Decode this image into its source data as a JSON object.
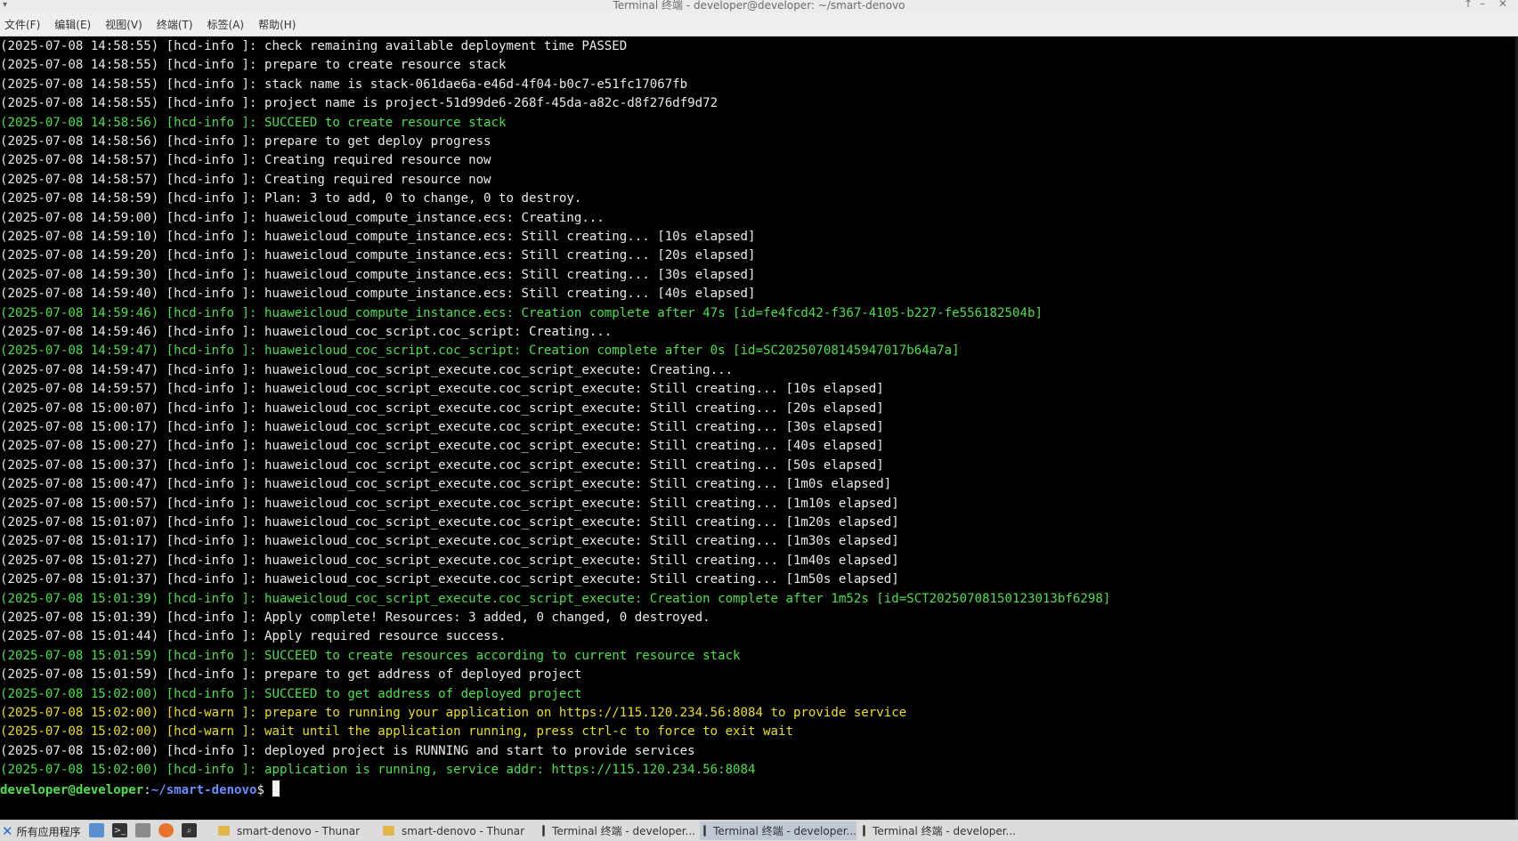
{
  "window": {
    "title": "Terminal 终端 - developer@developer: ~/smart-denovo",
    "menu_glyph": "▾",
    "controls": [
      "↑",
      "–",
      "✕"
    ]
  },
  "menu": [
    "文件(F)",
    "编辑(E)",
    "视图(V)",
    "终端(T)",
    "标签(A)",
    "帮助(H)"
  ],
  "terminal": {
    "lines": [
      {
        "text": "(2025-07-08 14:58:55) [hcd-info ]: check remaining available deployment time PASSED",
        "kind": "info"
      },
      {
        "text": "(2025-07-08 14:58:55) [hcd-info ]: prepare to create resource stack",
        "kind": "info"
      },
      {
        "text": "(2025-07-08 14:58:55) [hcd-info ]: stack name is stack-061dae6a-e46d-4f04-b0c7-e51fc17067fb",
        "kind": "info"
      },
      {
        "text": "(2025-07-08 14:58:55) [hcd-info ]: project name is project-51d99de6-268f-45da-a82c-d8f276df9d72",
        "kind": "info"
      },
      {
        "text": "(2025-07-08 14:58:56) [hcd-info ]: SUCCEED to create resource stack",
        "kind": "success"
      },
      {
        "text": "(2025-07-08 14:58:56) [hcd-info ]: prepare to get deploy progress",
        "kind": "info"
      },
      {
        "text": "(2025-07-08 14:58:57) [hcd-info ]: Creating required resource now",
        "kind": "info"
      },
      {
        "text": "(2025-07-08 14:58:57) [hcd-info ]: Creating required resource now",
        "kind": "info"
      },
      {
        "text": "(2025-07-08 14:58:59) [hcd-info ]: Plan: 3 to add, 0 to change, 0 to destroy.",
        "kind": "info"
      },
      {
        "text": "(2025-07-08 14:59:00) [hcd-info ]: huaweicloud_compute_instance.ecs: Creating...",
        "kind": "info"
      },
      {
        "text": "(2025-07-08 14:59:10) [hcd-info ]: huaweicloud_compute_instance.ecs: Still creating... [10s elapsed]",
        "kind": "info"
      },
      {
        "text": "(2025-07-08 14:59:20) [hcd-info ]: huaweicloud_compute_instance.ecs: Still creating... [20s elapsed]",
        "kind": "info"
      },
      {
        "text": "(2025-07-08 14:59:30) [hcd-info ]: huaweicloud_compute_instance.ecs: Still creating... [30s elapsed]",
        "kind": "info"
      },
      {
        "text": "(2025-07-08 14:59:40) [hcd-info ]: huaweicloud_compute_instance.ecs: Still creating... [40s elapsed]",
        "kind": "info"
      },
      {
        "text": "(2025-07-08 14:59:46) [hcd-info ]: huaweicloud_compute_instance.ecs: Creation complete after 47s [id=fe4fcd42-f367-4105-b227-fe556182504b]",
        "kind": "success"
      },
      {
        "text": "(2025-07-08 14:59:46) [hcd-info ]: huaweicloud_coc_script.coc_script: Creating...",
        "kind": "info"
      },
      {
        "text": "(2025-07-08 14:59:47) [hcd-info ]: huaweicloud_coc_script.coc_script: Creation complete after 0s [id=SC20250708145947017b64a7a]",
        "kind": "success"
      },
      {
        "text": "(2025-07-08 14:59:47) [hcd-info ]: huaweicloud_coc_script_execute.coc_script_execute: Creating...",
        "kind": "info"
      },
      {
        "text": "(2025-07-08 14:59:57) [hcd-info ]: huaweicloud_coc_script_execute.coc_script_execute: Still creating... [10s elapsed]",
        "kind": "info"
      },
      {
        "text": "(2025-07-08 15:00:07) [hcd-info ]: huaweicloud_coc_script_execute.coc_script_execute: Still creating... [20s elapsed]",
        "kind": "info"
      },
      {
        "text": "(2025-07-08 15:00:17) [hcd-info ]: huaweicloud_coc_script_execute.coc_script_execute: Still creating... [30s elapsed]",
        "kind": "info"
      },
      {
        "text": "(2025-07-08 15:00:27) [hcd-info ]: huaweicloud_coc_script_execute.coc_script_execute: Still creating... [40s elapsed]",
        "kind": "info"
      },
      {
        "text": "(2025-07-08 15:00:37) [hcd-info ]: huaweicloud_coc_script_execute.coc_script_execute: Still creating... [50s elapsed]",
        "kind": "info"
      },
      {
        "text": "(2025-07-08 15:00:47) [hcd-info ]: huaweicloud_coc_script_execute.coc_script_execute: Still creating... [1m0s elapsed]",
        "kind": "info"
      },
      {
        "text": "(2025-07-08 15:00:57) [hcd-info ]: huaweicloud_coc_script_execute.coc_script_execute: Still creating... [1m10s elapsed]",
        "kind": "info"
      },
      {
        "text": "(2025-07-08 15:01:07) [hcd-info ]: huaweicloud_coc_script_execute.coc_script_execute: Still creating... [1m20s elapsed]",
        "kind": "info"
      },
      {
        "text": "(2025-07-08 15:01:17) [hcd-info ]: huaweicloud_coc_script_execute.coc_script_execute: Still creating... [1m30s elapsed]",
        "kind": "info"
      },
      {
        "text": "(2025-07-08 15:01:27) [hcd-info ]: huaweicloud_coc_script_execute.coc_script_execute: Still creating... [1m40s elapsed]",
        "kind": "info"
      },
      {
        "text": "(2025-07-08 15:01:37) [hcd-info ]: huaweicloud_coc_script_execute.coc_script_execute: Still creating... [1m50s elapsed]",
        "kind": "info"
      },
      {
        "text": "(2025-07-08 15:01:39) [hcd-info ]: huaweicloud_coc_script_execute.coc_script_execute: Creation complete after 1m52s [id=SCT20250708150123013bf6298]",
        "kind": "success"
      },
      {
        "text": "(2025-07-08 15:01:39) [hcd-info ]: Apply complete! Resources: 3 added, 0 changed, 0 destroyed.",
        "kind": "info"
      },
      {
        "text": "(2025-07-08 15:01:44) [hcd-info ]: Apply required resource success.",
        "kind": "info"
      },
      {
        "text": "(2025-07-08 15:01:59) [hcd-info ]: SUCCEED to create resources according to current resource stack",
        "kind": "success"
      },
      {
        "text": "(2025-07-08 15:01:59) [hcd-info ]: prepare to get address of deployed project",
        "kind": "info"
      },
      {
        "text": "(2025-07-08 15:02:00) [hcd-info ]: SUCCEED to get address of deployed project",
        "kind": "success"
      },
      {
        "text": "(2025-07-08 15:02:00) [hcd-warn ]: prepare to running your application on https://115.120.234.56:8084 to provide service",
        "kind": "warn"
      },
      {
        "text": "(2025-07-08 15:02:00) [hcd-warn ]: wait until the application running, press ctrl-c to force to exit wait",
        "kind": "warn"
      },
      {
        "text": "(2025-07-08 15:02:00) [hcd-info ]: deployed project is RUNNING and start to provide services",
        "kind": "info"
      },
      {
        "text": "(2025-07-08 15:02:00) [hcd-info ]: application is running, service addr: https://115.120.234.56:8084",
        "kind": "success"
      }
    ],
    "prompt": {
      "user": "developer@developer",
      "sep": ":",
      "path": "~/smart-denovo",
      "symbol": "$"
    }
  },
  "taskbar": {
    "start_label": "所有应用程序",
    "tasks": [
      {
        "label": "smart-denovo - Thunar",
        "icon": "folder",
        "active": false
      },
      {
        "label": "smart-denovo - Thunar",
        "icon": "folder",
        "active": false
      },
      {
        "label": "Terminal 终端 - developer...",
        "icon": "terminal",
        "active": false
      },
      {
        "label": "Terminal 终端 - developer...",
        "icon": "terminal",
        "active": true
      },
      {
        "label": "Terminal 终端 - developer...",
        "icon": "terminal",
        "active": false
      }
    ]
  }
}
